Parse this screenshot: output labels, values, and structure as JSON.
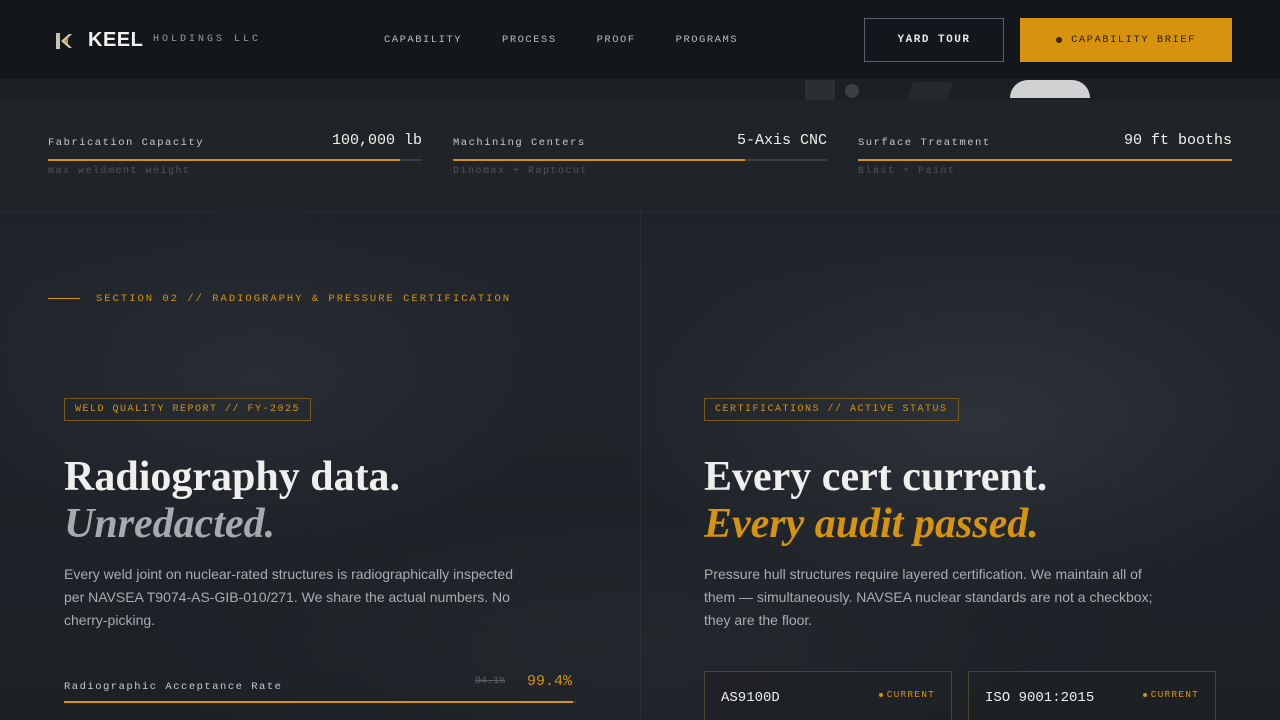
{
  "colors": {
    "accent": "#d8930e",
    "background": "#1b1f24",
    "header": "#14171b"
  },
  "brand": {
    "logo_icon": "keel-mark-icon",
    "name": "KEEL",
    "sub": "HOLDINGS LLC"
  },
  "nav": {
    "items": [
      "CAPABILITY",
      "PROCESS",
      "PROOF",
      "PROGRAMS"
    ]
  },
  "header": {
    "tour_label": "YARD TOUR",
    "brief_label": "CAPABILITY BRIEF"
  },
  "stats": [
    {
      "label": "Fabrication Capacity",
      "value": "100,000 lb",
      "sub": "max weldment weight",
      "fill_percent": 94
    },
    {
      "label": "Machining Centers",
      "value": "5-Axis CNC",
      "sub": "Dinomax + Raptocut",
      "fill_percent": 78
    },
    {
      "label": "Surface Treatment",
      "value": "90 ft booths",
      "sub": "Blast + Paint",
      "fill_percent": 100
    }
  ],
  "section": {
    "label": "SECTION 02 // RADIOGRAPHY & PRESSURE CERTIFICATION"
  },
  "weld": {
    "tag": "WELD QUALITY REPORT // FY-2025",
    "title_line1": "Radiography data.",
    "title_line2": "Unredacted.",
    "description": "Every weld joint on nuclear-rated structures is radiographically inspected per NAVSEA T9074-AS-GIB-010/271. We share the actual numbers. No cherry-picking.",
    "rate_label": "Radiographic Acceptance Rate",
    "rate_previous": "94.1%",
    "rate_current": "99.4%",
    "rate_percent": 99.4
  },
  "certs": {
    "tag": "CERTIFICATIONS // ACTIVE STATUS",
    "title_line1": "Every cert current.",
    "title_line2": "Every audit passed.",
    "description": "Pressure hull structures require layered certification. We maintain all of them — simultaneously. NAVSEA nuclear standards are not a checkbox; they are the floor.",
    "cards": [
      {
        "name": "AS9100D",
        "status": "CURRENT"
      },
      {
        "name": "ISO 9001:2015",
        "status": "CURRENT"
      }
    ]
  }
}
